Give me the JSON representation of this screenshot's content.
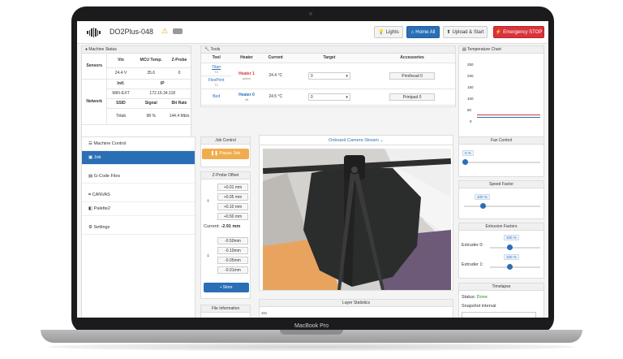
{
  "laptop": {
    "label": "MacBook Pro"
  },
  "header": {
    "title": "DO2Plus-048",
    "buttons": {
      "lights": "Lights",
      "home_all": "Home All",
      "upload_start": "Upload & Start",
      "emergency": "Emergency STOP"
    }
  },
  "machine_status": {
    "title": "Machine Status",
    "sensors_label": "Sensors",
    "sensor_headers": [
      "Vin",
      "MCU Temp.",
      "Z-Probe"
    ],
    "sensor_values": [
      "24.4 V",
      "35.6",
      "0"
    ],
    "network_label": "Network",
    "net_headers": [
      "Intf.",
      "IP"
    ],
    "net_values": [
      "WiFi-EXT",
      "172.16.34.118"
    ],
    "net_headers2": [
      "SSID",
      "Signal",
      "Bit Rate"
    ],
    "net_values2": [
      "Trilab",
      "98 %",
      "144.4 Mb/s"
    ]
  },
  "tools": {
    "title": "Tools",
    "headers": [
      "Tool",
      "Heater",
      "Current",
      "Target",
      "Accessories"
    ],
    "rows": [
      {
        "tool": "Titan",
        "sub": "T0",
        "heater": "Heater 1",
        "state": "active",
        "current": "24.4 °C",
        "target": "0",
        "accessory": "Printhead 0"
      },
      {
        "tool": "FlexPrint",
        "sub": "T1",
        "heater": "",
        "state": "",
        "current": "",
        "target": "",
        "accessory": ""
      },
      {
        "tool": "Bed",
        "sub": "",
        "heater": "Heater 0",
        "state": "off",
        "current": "24.5 °C",
        "target": "0",
        "accessory": "Printpad 0"
      }
    ]
  },
  "temperature_chart": {
    "title": "Temperature Chart",
    "y_ticks": [
      "250",
      "200",
      "150",
      "100",
      "50",
      "0"
    ]
  },
  "machine_control": {
    "title": "Machine Control",
    "items": [
      "Job",
      "G-Code Files",
      "CANVAS",
      "Palette2",
      "Settings"
    ]
  },
  "job_control": {
    "title": "Job Control",
    "pause": "Pause Job"
  },
  "zprobe": {
    "title": "Z-Probe Offset",
    "up": [
      "+0.01 mm",
      "+0.05 mm",
      "+0.10 mm",
      "+0.50 mm"
    ],
    "current_label": "Current:",
    "current_value": "-2.91 mm",
    "down": [
      "-0.50mm",
      "-0.10mm",
      "-0.05mm",
      "-0.01mm"
    ],
    "store": "Store"
  },
  "file_info": {
    "title": "File Information"
  },
  "camera": {
    "title": "Onboard Camera Stream"
  },
  "layer_stats": {
    "title": "Layer Statistics",
    "y_tick": "30s"
  },
  "fan_control": {
    "title": "Fan Control",
    "value": "0 %",
    "fraction": 0.0
  },
  "speed_factor": {
    "title": "Speed Factor",
    "value": "100 %"
  },
  "extrusion": {
    "title": "Extrusion Factors",
    "extruders": [
      {
        "label": "Extruder 0:",
        "value": "100 %"
      },
      {
        "label": "Extruder 1:",
        "value": "100 %"
      }
    ]
  },
  "timelapse": {
    "title": "Timelapse",
    "status_label": "Status:",
    "status_value": "Done",
    "snapshot_label": "Snapshot interval"
  },
  "colors": {
    "primary": "#2a6fb6",
    "danger": "#d9333c",
    "warning": "#f0ad4e",
    "success": "#2e8b2e"
  }
}
